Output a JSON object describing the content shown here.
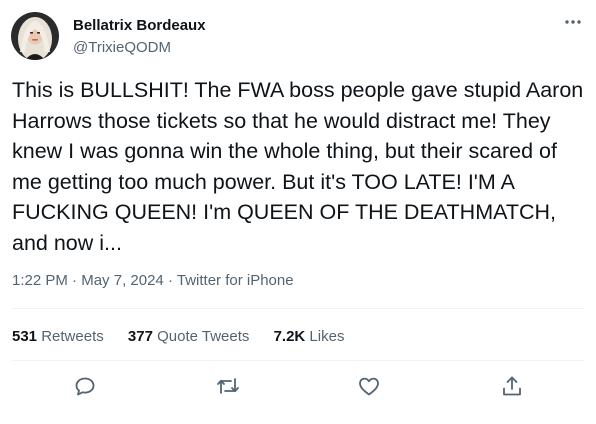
{
  "user": {
    "display_name": "Bellatrix Bordeaux",
    "handle": "@TrixieQODM"
  },
  "tweet": {
    "text": "This is BULLSHIT! The FWA boss people gave stupid Aaron Harrows those tickets so that he would distract me! They knew I was gonna win the whole thing, but their scared of me getting too much power. But it's TOO LATE! I'M A FUCKING QUEEN! I'm QUEEN OF THE DEATHMATCH, and now i...",
    "time": "1:22 PM",
    "date": "May 7, 2024",
    "source": "Twitter for iPhone",
    "separator": "·"
  },
  "stats": {
    "retweets_count": "531",
    "retweets_label": "Retweets",
    "quote_count": "377",
    "quote_label": "Quote Tweets",
    "likes_count": "7.2K",
    "likes_label": "Likes"
  },
  "icons": {
    "more": "more-horizontal-icon",
    "reply": "reply-icon",
    "retweet": "retweet-icon",
    "like": "like-icon",
    "share": "share-icon"
  },
  "colors": {
    "text_primary": "#0f1419",
    "text_secondary": "#536471",
    "divider": "#eff3f4"
  }
}
